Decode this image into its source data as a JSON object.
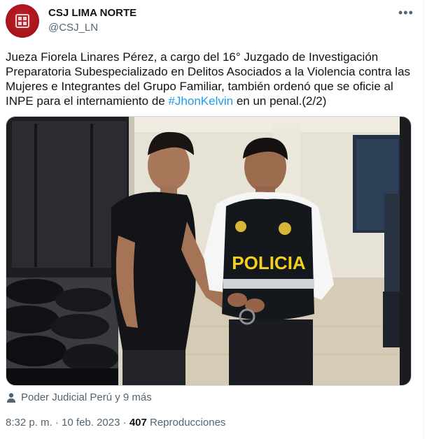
{
  "account": {
    "name": "CSJ LIMA NORTE",
    "handle": "@CSJ_LN",
    "more_icon": "more-horizontal-icon",
    "brand_color": "#b5171f"
  },
  "tweet": {
    "text_before": "Jueza Fiorela Linares Pérez, a cargo del 16° Juzgado de Investigación Preparatoria Subespecializado en Delitos Asociados a la Violencia contra las Mujeres e Integrantes del Grupo Familiar, también ordenó que se oficie al INPE para el internamiento de ",
    "hashtag": "#JhonKelvin",
    "text_after": " en un penal.(2/2)",
    "hashtag_color": "#1d9bf0"
  },
  "media": {
    "vest_text": "POLICIA"
  },
  "tagged": {
    "icon": "person-icon",
    "text": "Poder Judicial Perú y 9 más"
  },
  "meta": {
    "time": "8:32 p. m.",
    "separator": " · ",
    "date": "10 feb. 2023",
    "views_count": "407",
    "views_label": " Reproducciones"
  }
}
